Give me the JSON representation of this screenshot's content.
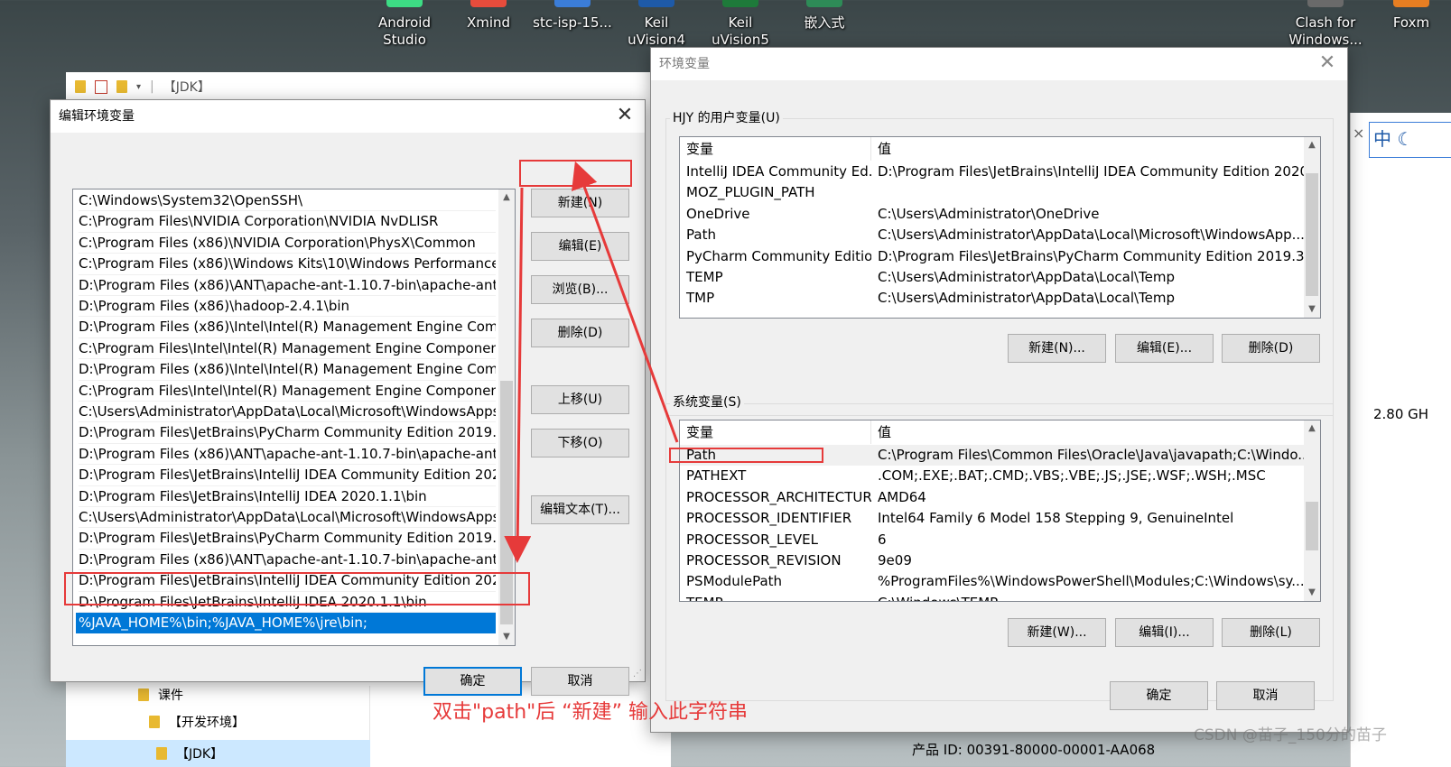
{
  "desktop": {
    "icons": [
      {
        "label": "Android\nStudio",
        "color": "#3ddc84"
      },
      {
        "label": "Xmind",
        "color": "#e74c3c"
      },
      {
        "label": "stc-isp-15...",
        "color": "#3b7dd8"
      },
      {
        "label": "Keil\nuVision4",
        "color": "#1e5aa8"
      },
      {
        "label": "Keil\nuVision5",
        "color": "#1e7a3a"
      },
      {
        "label": "嵌入式",
        "color": "#2e8b57"
      },
      {
        "label": "Clash for\nWindows...",
        "color": "#6a6a6a"
      },
      {
        "label": "Foxm",
        "color": "#e67e22"
      }
    ]
  },
  "explorer": {
    "breadcrumb": "【JDK】",
    "tree": [
      "课件",
      "【开发环境】",
      "【JDK】"
    ],
    "product_id": "产品 ID: 00391-80000-00001-AA068",
    "cpu_text": "2.80 GH",
    "ime_text": "中"
  },
  "edit_dialog": {
    "title": "编辑环境变量",
    "paths": [
      "C:\\Windows\\System32\\OpenSSH\\",
      "C:\\Program Files\\NVIDIA Corporation\\NVIDIA NvDLISR",
      "C:\\Program Files (x86)\\NVIDIA Corporation\\PhysX\\Common",
      "C:\\Program Files (x86)\\Windows Kits\\10\\Windows Performance...",
      "D:\\Program Files (x86)\\ANT\\apache-ant-1.10.7-bin\\apache-ant-...",
      "D:\\Program Files (x86)\\hadoop-2.4.1\\bin",
      "D:\\Program Files (x86)\\Intel\\Intel(R) Management Engine Comp...",
      "C:\\Program Files\\Intel\\Intel(R) Management Engine Componen...",
      "D:\\Program Files (x86)\\Intel\\Intel(R) Management Engine Comp...",
      "C:\\Program Files\\Intel\\Intel(R) Management Engine Componen...",
      "C:\\Users\\Administrator\\AppData\\Local\\Microsoft\\WindowsApps",
      "D:\\Program Files\\JetBrains\\PyCharm Community Edition 2019.3....",
      "D:\\Program Files (x86)\\ANT\\apache-ant-1.10.7-bin\\apache-ant-...",
      "D:\\Program Files\\JetBrains\\IntelliJ IDEA Community Edition 202...",
      "D:\\Program Files\\JetBrains\\IntelliJ IDEA 2020.1.1\\bin",
      "C:\\Users\\Administrator\\AppData\\Local\\Microsoft\\WindowsApps",
      "D:\\Program Files\\JetBrains\\PyCharm Community Edition 2019.3....",
      "D:\\Program Files (x86)\\ANT\\apache-ant-1.10.7-bin\\apache-ant-...",
      "D:\\Program Files\\JetBrains\\IntelliJ IDEA Community Edition 202...",
      "D:\\Program Files\\JetBrains\\IntelliJ IDEA 2020.1.1\\bin"
    ],
    "selected_path": "%JAVA_HOME%\\bin;%JAVA_HOME%\\jre\\bin;",
    "buttons": {
      "new": "新建(N)",
      "edit": "编辑(E)",
      "browse": "浏览(B)...",
      "delete": "删除(D)",
      "move_up": "上移(U)",
      "move_down": "下移(O)",
      "edit_text": "编辑文本(T)...",
      "ok": "确定",
      "cancel": "取消"
    }
  },
  "env_dialog": {
    "title": "环境变量",
    "user_group_title": "HJY 的用户变量(U)",
    "system_group_title": "系统变量(S)",
    "col_var": "变量",
    "col_val": "值",
    "user_vars": [
      {
        "name": "IntelliJ IDEA Community Ed...",
        "value": "D:\\Program Files\\JetBrains\\IntelliJ IDEA Community Edition 2020..."
      },
      {
        "name": "MOZ_PLUGIN_PATH",
        "value": ""
      },
      {
        "name": "OneDrive",
        "value": "C:\\Users\\Administrator\\OneDrive"
      },
      {
        "name": "Path",
        "value": "C:\\Users\\Administrator\\AppData\\Local\\Microsoft\\WindowsApp..."
      },
      {
        "name": "PyCharm Community Edition",
        "value": "D:\\Program Files\\JetBrains\\PyCharm Community Edition 2019.3...."
      },
      {
        "name": "TEMP",
        "value": "C:\\Users\\Administrator\\AppData\\Local\\Temp"
      },
      {
        "name": "TMP",
        "value": "C:\\Users\\Administrator\\AppData\\Local\\Temp"
      }
    ],
    "system_vars": [
      {
        "name": "Path",
        "value": "C:\\Program Files\\Common Files\\Oracle\\Java\\javapath;C:\\Windo..."
      },
      {
        "name": "PATHEXT",
        "value": ".COM;.EXE;.BAT;.CMD;.VBS;.VBE;.JS;.JSE;.WSF;.WSH;.MSC"
      },
      {
        "name": "PROCESSOR_ARCHITECTURE",
        "value": "AMD64"
      },
      {
        "name": "PROCESSOR_IDENTIFIER",
        "value": "Intel64 Family 6 Model 158 Stepping 9, GenuineIntel"
      },
      {
        "name": "PROCESSOR_LEVEL",
        "value": "6"
      },
      {
        "name": "PROCESSOR_REVISION",
        "value": "9e09"
      },
      {
        "name": "PSModulePath",
        "value": "%ProgramFiles%\\WindowsPowerShell\\Modules;C:\\Windows\\sy..."
      },
      {
        "name": "TEMP",
        "value": "C:\\Windows\\TEMP"
      }
    ],
    "user_buttons": {
      "new": "新建(N)...",
      "edit": "编辑(E)...",
      "delete": "删除(D)"
    },
    "system_buttons": {
      "new": "新建(W)...",
      "edit": "编辑(I)...",
      "delete": "删除(L)"
    },
    "ok": "确定",
    "cancel": "取消"
  },
  "annotation": {
    "text": "双击\"path\"后 “新建” 输入此字符串",
    "color": "#e63a3a"
  },
  "watermark": "CSDN @苗子_150分的苗子"
}
